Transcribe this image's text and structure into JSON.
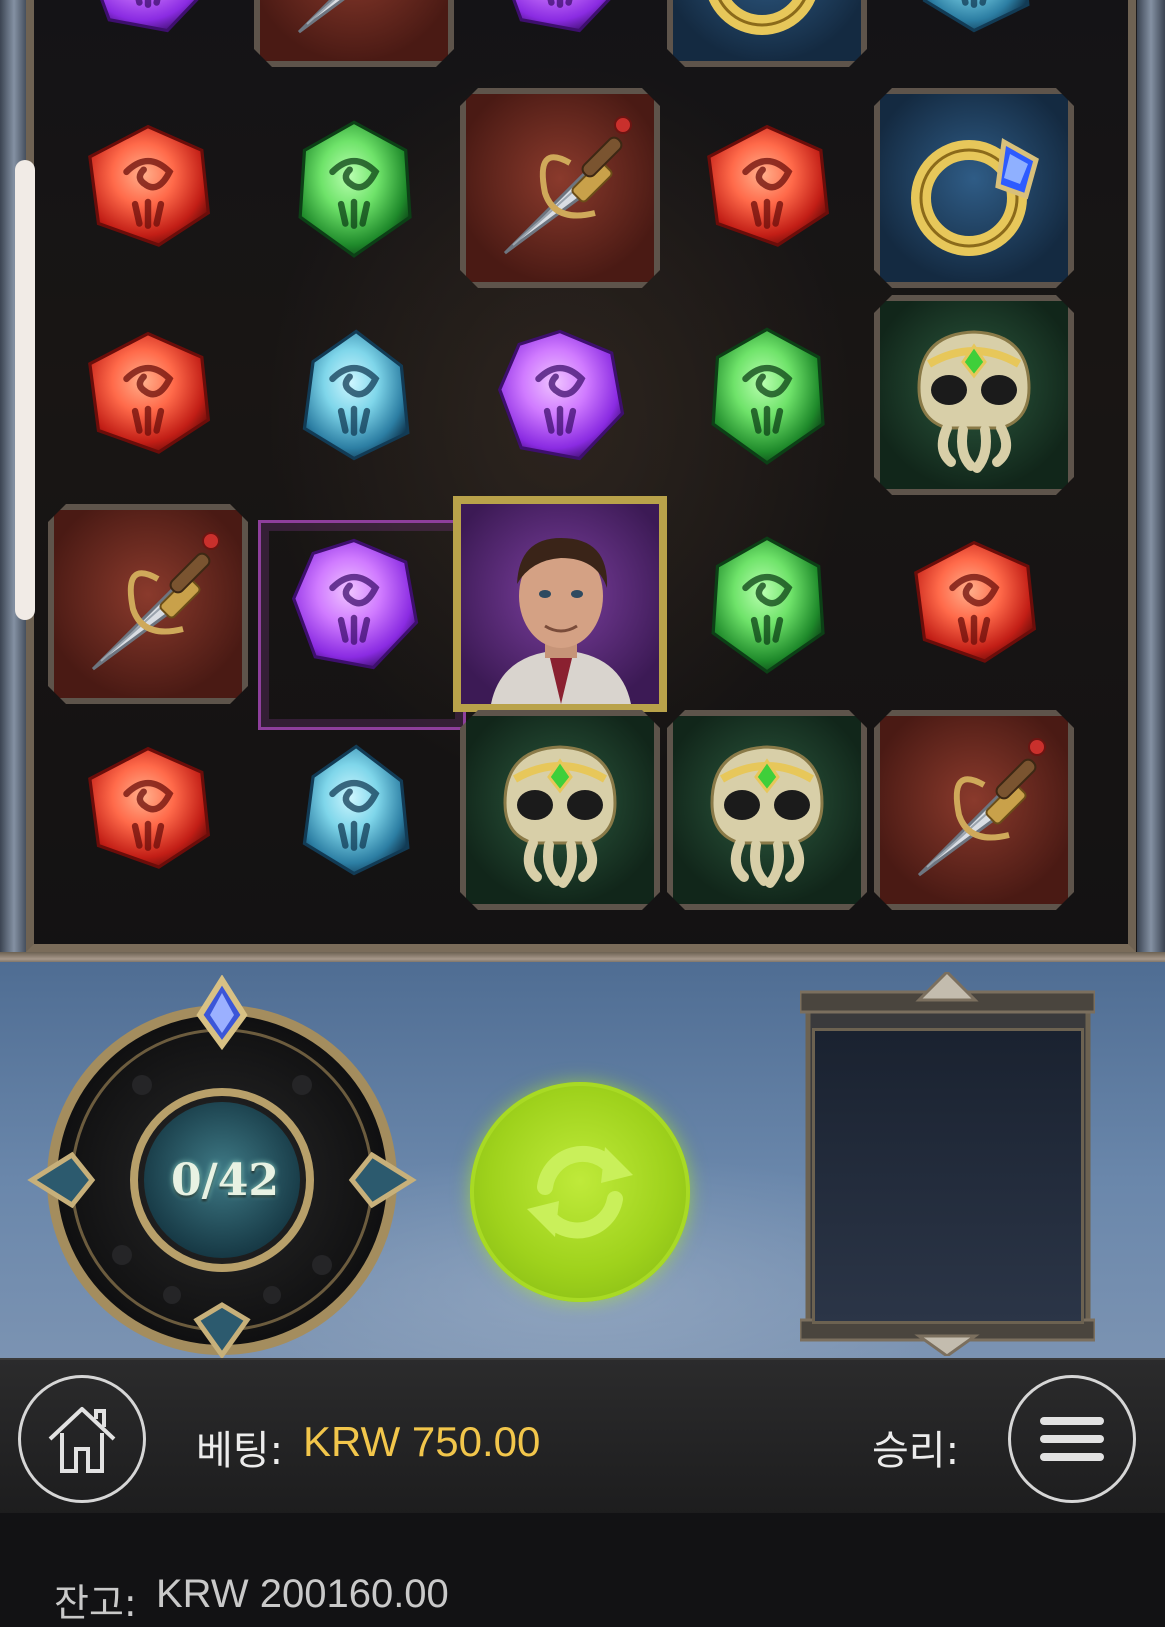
{
  "grid": {
    "columns": 5,
    "rows": [
      [
        "purple-gem",
        "dagger",
        "purple-gem",
        "ring",
        "blue-gem"
      ],
      [
        "red-gem",
        "green-gem",
        "dagger",
        "red-gem",
        "ring"
      ],
      [
        "red-gem",
        "blue-gem",
        "purple-gem",
        "green-gem",
        "skull"
      ],
      [
        "dagger",
        "purple-gem",
        "portrait",
        "green-gem",
        "red-gem"
      ],
      [
        "red-gem",
        "blue-gem",
        "skull",
        "skull",
        "dagger"
      ]
    ],
    "highlighted_cell": {
      "row": 3,
      "col": 1
    }
  },
  "dial": {
    "counter": "0/42"
  },
  "bottom_bar": {
    "bet_label": "베팅:",
    "bet_value": "KRW 750.00",
    "win_label": "승리:",
    "balance_label": "잔고:",
    "balance_value": "KRW 200160.00"
  },
  "colors": {
    "accent_spin": "#9fd21c",
    "bet_value": "#f2c64b",
    "panel_blue": "#6a87ab",
    "frame_gold": "#b9a24a"
  },
  "icons": {
    "home": "home-icon",
    "menu": "hamburger-menu-icon",
    "spin": "spin-arrows-icon"
  }
}
